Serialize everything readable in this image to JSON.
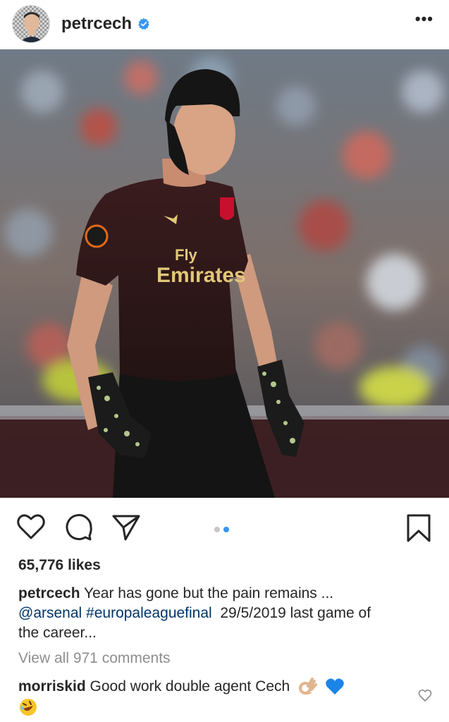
{
  "header": {
    "username": "petrcech",
    "more_label": "•••"
  },
  "post": {
    "carousel": {
      "count": 2,
      "active_index": 1
    },
    "likes": "65,776 likes",
    "caption": {
      "user": "petrcech",
      "line1": "Year has gone but the pain remains ...",
      "mention": "@arsenal",
      "hashtag": "#europaleaguefinal",
      "line2_rest": "29/5/2019 last game of",
      "line3": "the career..."
    },
    "view_all": "View all 971 comments",
    "comment": {
      "user": "morriskid",
      "text": "Good work double agent Cech"
    }
  },
  "colors": {
    "link": "#003569",
    "dot_active": "#3897f0",
    "muted": "#8e8e8e",
    "verified": "#3897f0"
  }
}
